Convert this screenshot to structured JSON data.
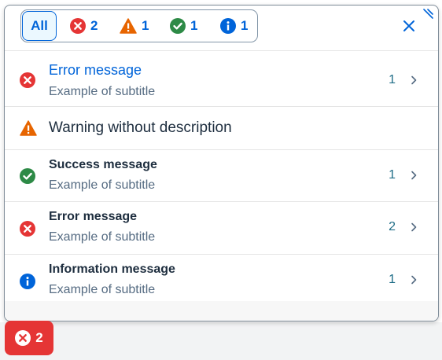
{
  "filters": {
    "all_label": "All",
    "error_count": "2",
    "warning_count": "1",
    "success_count": "1",
    "info_count": "1"
  },
  "messages": [
    {
      "type": "error",
      "title": "Error message",
      "subtitle": "Example of subtitle",
      "count": "1"
    },
    {
      "type": "warning",
      "title": "Warning without description"
    },
    {
      "type": "success",
      "title": "Success message",
      "subtitle": "Example of subtitle",
      "count": "1"
    },
    {
      "type": "error",
      "title": "Error message",
      "subtitle": "Example of subtitle",
      "count": "2"
    },
    {
      "type": "information",
      "title": "Information message",
      "subtitle": "Example of subtitle",
      "count": "1"
    }
  ],
  "trigger_button": {
    "count": "2"
  },
  "colors": {
    "error": "#e53535",
    "warning": "#e76500",
    "success": "#2d8a46",
    "information": "#0064d9",
    "accent": "#0064d9"
  },
  "icons": {
    "error": "error-icon",
    "warning": "warning-icon",
    "success": "success-icon",
    "information": "information-icon",
    "close": "close-icon",
    "chevron": "chevron-right-icon",
    "resize": "resize-handle-icon"
  }
}
